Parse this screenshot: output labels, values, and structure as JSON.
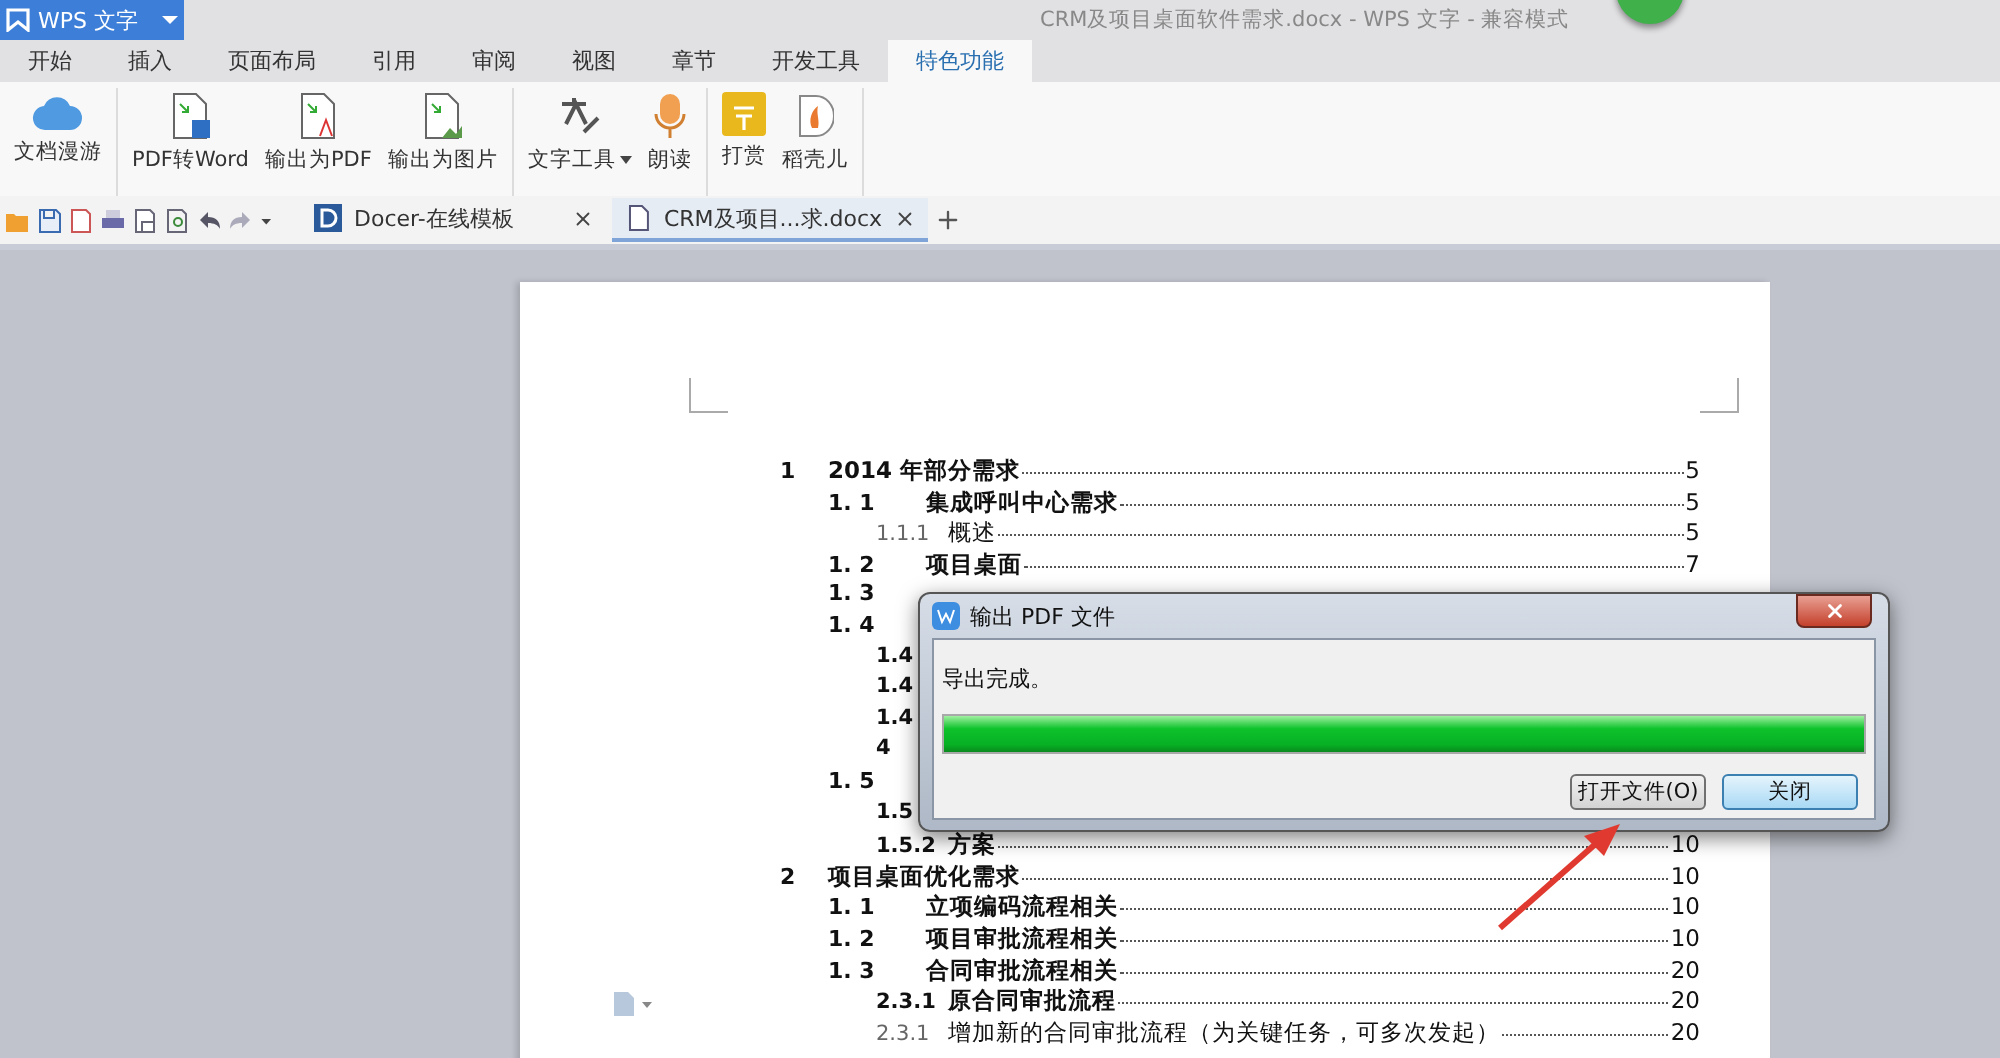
{
  "app_button": {
    "label": "WPS 文字"
  },
  "window": {
    "title": "CRM及项目桌面软件需求.docx - WPS 文字 - 兼容模式"
  },
  "menu_tabs": [
    {
      "label": "开始",
      "selected": false
    },
    {
      "label": "插入",
      "selected": false
    },
    {
      "label": "页面布局",
      "selected": false
    },
    {
      "label": "引用",
      "selected": false
    },
    {
      "label": "审阅",
      "selected": false
    },
    {
      "label": "视图",
      "selected": false
    },
    {
      "label": "章节",
      "selected": false
    },
    {
      "label": "开发工具",
      "selected": false
    },
    {
      "label": "特色功能",
      "selected": true
    }
  ],
  "ribbon": {
    "groups": [
      {
        "items": [
          {
            "label": "文档漫游",
            "kind": "cloud"
          }
        ]
      },
      {
        "items": [
          {
            "label": "PDF转Word",
            "kind": "word"
          },
          {
            "label": "输出为PDF",
            "kind": "pdf"
          },
          {
            "label": "输出为图片",
            "kind": "image"
          }
        ]
      },
      {
        "items": [
          {
            "label": "文字工具",
            "kind": "tools",
            "dropdown": true
          },
          {
            "label": "朗读",
            "kind": "mic"
          }
        ]
      },
      {
        "items": [
          {
            "label": "打赏",
            "kind": "reward"
          },
          {
            "label": "稻壳儿",
            "kind": "shell"
          }
        ]
      }
    ]
  },
  "doc_tabs": [
    {
      "label": "Docer-在线模板",
      "selected": false
    },
    {
      "label": "CRM及项目...求.docx",
      "selected": true
    }
  ],
  "toc": [
    {
      "number": "1",
      "title": "2014 年部分需求",
      "page": "5",
      "bold": true,
      "children": [
        {
          "number": "1. 1",
          "title": "集成呼叫中心需求",
          "page": "5",
          "bold": true,
          "children": [
            {
              "number": "1.1.1",
              "title": "概述",
              "page": "5",
              "bold": false
            }
          ]
        },
        {
          "number": "1. 2",
          "title": "项目桌面",
          "page": "7",
          "bold": true
        },
        {
          "number": "1. 3",
          "bold": true
        },
        {
          "number": "1. 4",
          "bold": true,
          "children": [
            {
              "number": "1.4",
              "bold": true
            },
            {
              "number": "1.4",
              "bold": true
            },
            {
              "number": "1.4",
              "bold": true
            },
            {
              "number": "4",
              "bold": true
            }
          ]
        },
        {
          "number": "1. 5",
          "bold": true,
          "children": [
            {
              "number": "1.5",
              "bold": true
            },
            {
              "number": "1.5.2",
              "title": "方案",
              "page": "10",
              "bold": true
            }
          ]
        }
      ]
    },
    {
      "number": "2",
      "title": "项目桌面优化需求",
      "page": "10",
      "bold": true,
      "children": [
        {
          "number": "1. 1",
          "title": "立项编码流程相关",
          "page": "10",
          "bold": true
        },
        {
          "number": "1. 2",
          "title": "项目审批流程相关",
          "page": "10",
          "bold": true
        },
        {
          "number": "1. 3",
          "title": "合同审批流程相关",
          "page": "20",
          "bold": true,
          "children": [
            {
              "number": "2.3.1",
              "title": "原合同审批流程",
              "page": "20",
              "bold": true
            },
            {
              "number": "2.3.1",
              "title": "增加新的合同审批流程（为关键任务，可多次发起）",
              "page": "20",
              "bold": false
            }
          ]
        }
      ]
    }
  ],
  "dialog": {
    "title": "输出 PDF 文件",
    "message": "导出完成。",
    "progress": {
      "level": 1
    },
    "buttons": [
      {
        "label": "打开文件(O)",
        "selected": false
      },
      {
        "label": "关闭",
        "selected": true
      }
    ]
  }
}
